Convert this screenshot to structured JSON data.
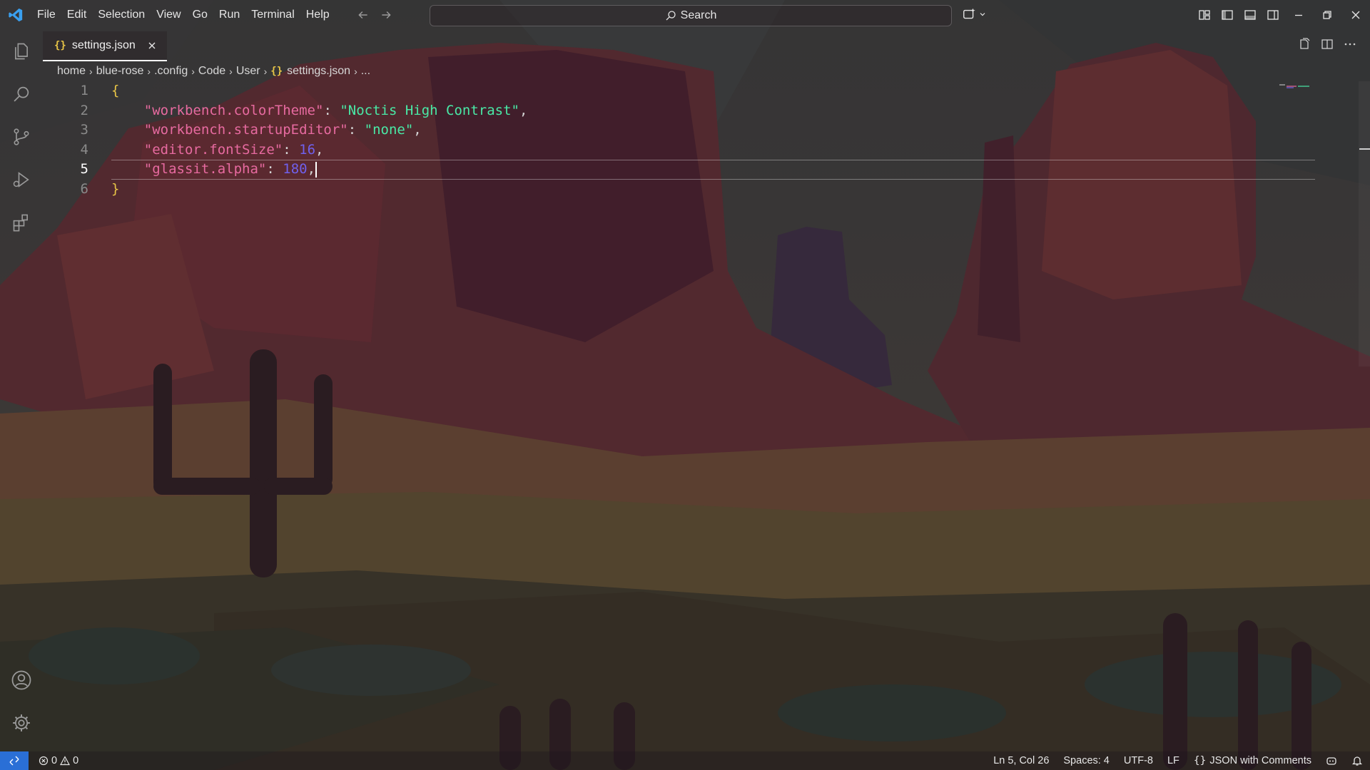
{
  "colors": {
    "accent": "#2a6fd6",
    "json_icon": "#e8c547",
    "string": "#49e9a6",
    "key": "#e76aa0",
    "number": "#7060eb",
    "brace": "#e8c547"
  },
  "titlebar": {
    "menu": [
      "File",
      "Edit",
      "Selection",
      "View",
      "Go",
      "Run",
      "Terminal",
      "Help"
    ],
    "search_label": "Search",
    "icons": [
      "vscode-logo-icon",
      "arrow-left-icon",
      "arrow-right-icon",
      "copilot-icon",
      "customize-layout-icon",
      "toggle-primary-sidebar-icon",
      "toggle-panel-icon",
      "toggle-secondary-sidebar-icon",
      "minimize-icon",
      "restore-icon",
      "close-icon"
    ]
  },
  "activitybar": {
    "items": [
      "explorer-icon",
      "search-icon",
      "source-control-icon",
      "run-debug-icon",
      "extensions-icon"
    ],
    "bottom": [
      "accounts-icon",
      "manage-gear-icon"
    ]
  },
  "tabs": [
    {
      "icon": "{}",
      "label": "settings.json",
      "active": true
    }
  ],
  "breadcrumb": {
    "items": [
      "home",
      "blue-rose",
      ".config",
      "Code",
      "User"
    ],
    "file_icon": "{}",
    "file": "settings.json",
    "more": "..."
  },
  "editor": {
    "line_numbers": [
      "1",
      "2",
      "3",
      "4",
      "5",
      "6"
    ],
    "active_line": 5,
    "lines": [
      {
        "open": "{"
      },
      {
        "key": "\"workbench.colorTheme\"",
        "sep": ": ",
        "value": "\"Noctis High Contrast\"",
        "end": ","
      },
      {
        "key": "\"workbench.startupEditor\"",
        "sep": ": ",
        "value": "\"none\"",
        "end": ","
      },
      {
        "key": "\"editor.fontSize\"",
        "sep": ": ",
        "value": "16",
        "end": ","
      },
      {
        "key": "\"glassit.alpha\"",
        "sep": ": ",
        "value": "180",
        "end": ","
      },
      {
        "close": "}"
      }
    ]
  },
  "statusbar": {
    "errors": "0",
    "warnings": "0",
    "position": "Ln 5, Col 26",
    "spaces": "Spaces: 4",
    "encoding": "UTF-8",
    "eol": "LF",
    "language_icon": "{}",
    "language": "JSON with Comments"
  }
}
